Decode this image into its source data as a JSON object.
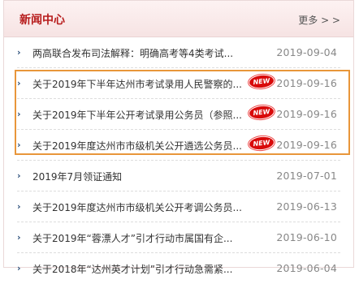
{
  "header": {
    "title": "新闻中心",
    "more_label": "更多 > >"
  },
  "news": [
    {
      "title": "两高联合发布司法解释：明确高考等4类考试...",
      "date": "2019-09-04",
      "is_new": false,
      "new_label": ""
    },
    {
      "title": "关于2019年下半年达州市考试录用人民警察的...",
      "date": "2019-09-16",
      "is_new": true,
      "new_label": "NEW"
    },
    {
      "title": "关于2019年下半年公开考试录用公务员（参照...",
      "date": "2019-09-16",
      "is_new": true,
      "new_label": "NEW"
    },
    {
      "title": "关于2019年度达州市市级机关公开遴选公务员...",
      "date": "2019-09-16",
      "is_new": true,
      "new_label": "NEW"
    },
    {
      "title": "2019年7月领证通知",
      "date": "2019-07-01",
      "is_new": false,
      "new_label": ""
    },
    {
      "title": "关于2019年度达州市市级机关公开考调公务员...",
      "date": "2019-06-13",
      "is_new": false,
      "new_label": ""
    },
    {
      "title": "关于2019年“蓉漂人才”引才行动市属国有企...",
      "date": "2019-06-10",
      "is_new": false,
      "new_label": ""
    },
    {
      "title": "关于2018年“达州英才计划”引才行动急需紧...",
      "date": "2019-06-04",
      "is_new": false,
      "new_label": ""
    }
  ],
  "colors": {
    "accent": "#b71c1c",
    "highlight_border": "#e8963a",
    "new_badge": "#d90a0a"
  }
}
